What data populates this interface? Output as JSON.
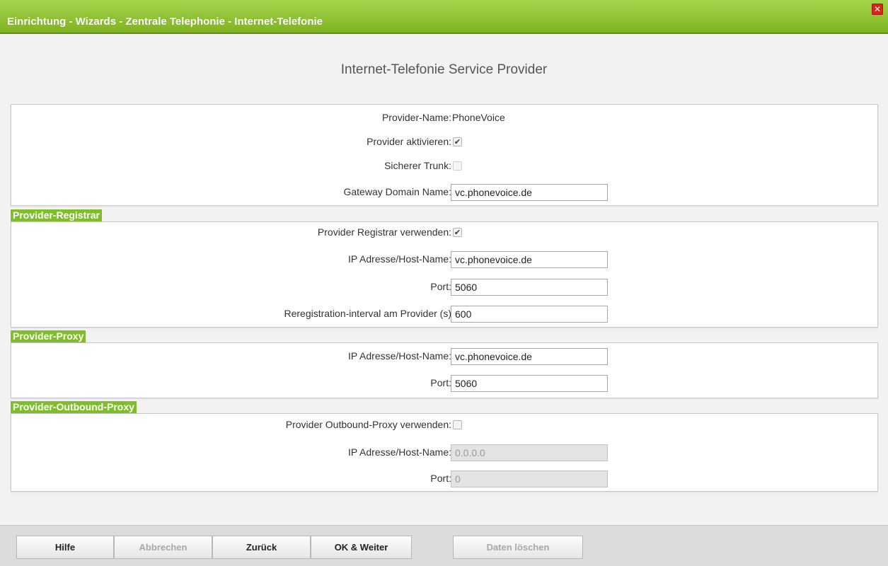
{
  "window": {
    "title": "Einrichtung - Wizards - Zentrale Telephonie - Internet-Telefonie",
    "close_symbol": "✕"
  },
  "page": {
    "subtitle": "Internet-Telefonie Service Provider"
  },
  "general": {
    "provider_name_label": "Provider-Name:",
    "provider_name_value": "PhoneVoice",
    "activate_label": "Provider aktivieren:",
    "activate_checked": true,
    "secure_trunk_label": "Sicherer Trunk:",
    "secure_trunk_checked": false,
    "gateway_label": "Gateway Domain Name:",
    "gateway_value": "vc.phonevoice.de"
  },
  "registrar": {
    "section_title": "Provider-Registrar",
    "use_label": "Provider Registrar verwenden:",
    "use_checked": true,
    "host_label": "IP Adresse/Host-Name:",
    "host_value": "vc.phonevoice.de",
    "port_label": "Port:",
    "port_value": "5060",
    "rereg_label": "Reregistration-interval am Provider (s)",
    "rereg_value": "600"
  },
  "proxy": {
    "section_title": "Provider-Proxy",
    "host_label": "IP Adresse/Host-Name:",
    "host_value": "vc.phonevoice.de",
    "port_label": "Port:",
    "port_value": "5060"
  },
  "outbound": {
    "section_title": "Provider-Outbound-Proxy",
    "use_label": "Provider Outbound-Proxy verwenden:",
    "use_checked": false,
    "host_label": "IP Adresse/Host-Name:",
    "host_value": "0.0.0.0",
    "port_label": "Port:",
    "port_value": "0"
  },
  "buttons": {
    "help": "Hilfe",
    "cancel": "Abbrechen",
    "back": "Zurück",
    "ok_next": "OK & Weiter",
    "delete_data": "Daten löschen"
  },
  "icons": {
    "checkmark": "✔"
  },
  "colors": {
    "accent": "#7fbd2a",
    "close": "#d9261c"
  }
}
